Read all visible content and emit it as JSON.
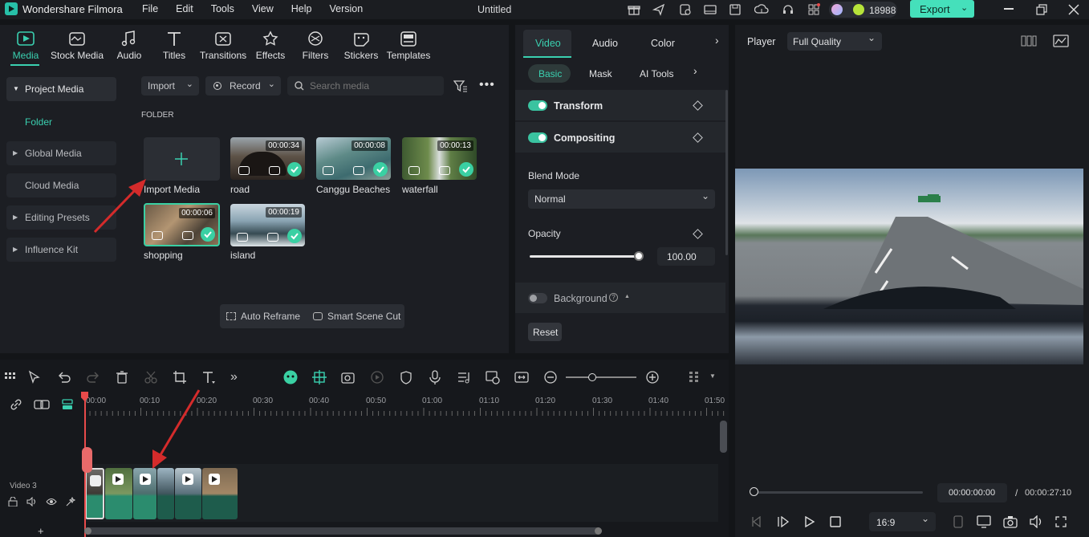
{
  "app": {
    "name": "Wondershare Filmora",
    "doc_title": "Untitled",
    "credits": "18988",
    "export_label": "Export"
  },
  "menu": [
    "File",
    "Edit",
    "Tools",
    "View",
    "Help",
    "Version"
  ],
  "media_tabs": [
    "Media",
    "Stock Media",
    "Audio",
    "Titles",
    "Transitions",
    "Effects",
    "Filters",
    "Stickers",
    "Templates"
  ],
  "sidebar": [
    "Project Media",
    "Folder",
    "Global Media",
    "Cloud Media",
    "Editing Presets",
    "Influence Kit"
  ],
  "media_toolbar": {
    "import": "Import",
    "record": "Record",
    "search_placeholder": "Search media"
  },
  "folder_label": "FOLDER",
  "import_media_label": "Import Media",
  "clips": [
    {
      "name": "road",
      "duration": "00:00:34"
    },
    {
      "name": "Canggu Beaches",
      "duration": "00:00:08"
    },
    {
      "name": "waterfall",
      "duration": "00:00:13"
    },
    {
      "name": "shopping",
      "duration": "00:00:06"
    },
    {
      "name": "island",
      "duration": "00:00:19"
    }
  ],
  "bottom_tools": {
    "auto_reframe": "Auto Reframe",
    "smart_scene_cut": "Smart Scene Cut"
  },
  "props": {
    "tabs": [
      "Video",
      "Audio",
      "Color"
    ],
    "subtabs": [
      "Basic",
      "Mask",
      "AI Tools"
    ],
    "transform": "Transform",
    "compositing": "Compositing",
    "blend_mode_label": "Blend Mode",
    "blend_mode_value": "Normal",
    "opacity_label": "Opacity",
    "opacity_value": "100.00",
    "background": "Background",
    "reset": "Reset"
  },
  "player": {
    "label": "Player",
    "quality": "Full Quality",
    "current": "00:00:00:00",
    "separator": "/",
    "total": "00:00:27:10",
    "aspect": "16:9",
    "progress": 0
  },
  "timeline": {
    "ruler": [
      "00:00",
      "00:10",
      "00:20",
      "00:30",
      "00:40",
      "00:50",
      "01:00",
      "01:10",
      "01:20",
      "01:30",
      "01:40",
      "01:50"
    ],
    "track_name": "Video 3",
    "zoom_level": 0.35
  }
}
